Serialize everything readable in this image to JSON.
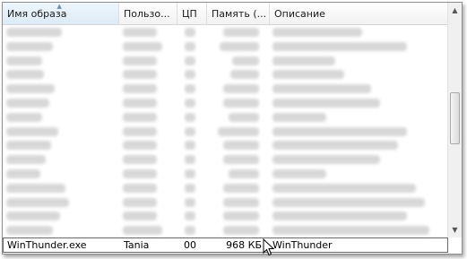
{
  "columns": [
    {
      "label": "Имя образа",
      "sorted": true
    },
    {
      "label": "Пользо..."
    },
    {
      "label": "ЦП"
    },
    {
      "label": "Память (..."
    },
    {
      "label": "Описание"
    }
  ],
  "selected_row": {
    "image_name": "WinThunder.exe",
    "user": "Tania",
    "cpu": "00",
    "memory": "968 КБ",
    "description": "WinThunder"
  },
  "colors": {
    "border": "#8e8f8f",
    "sorted_header": "#dcebf7",
    "blurred_text": "#b8b8b8"
  },
  "icons": [
    "sort-up-icon",
    "scroll-up-icon",
    "scroll-down-icon",
    "mouse-cursor-icon"
  ]
}
